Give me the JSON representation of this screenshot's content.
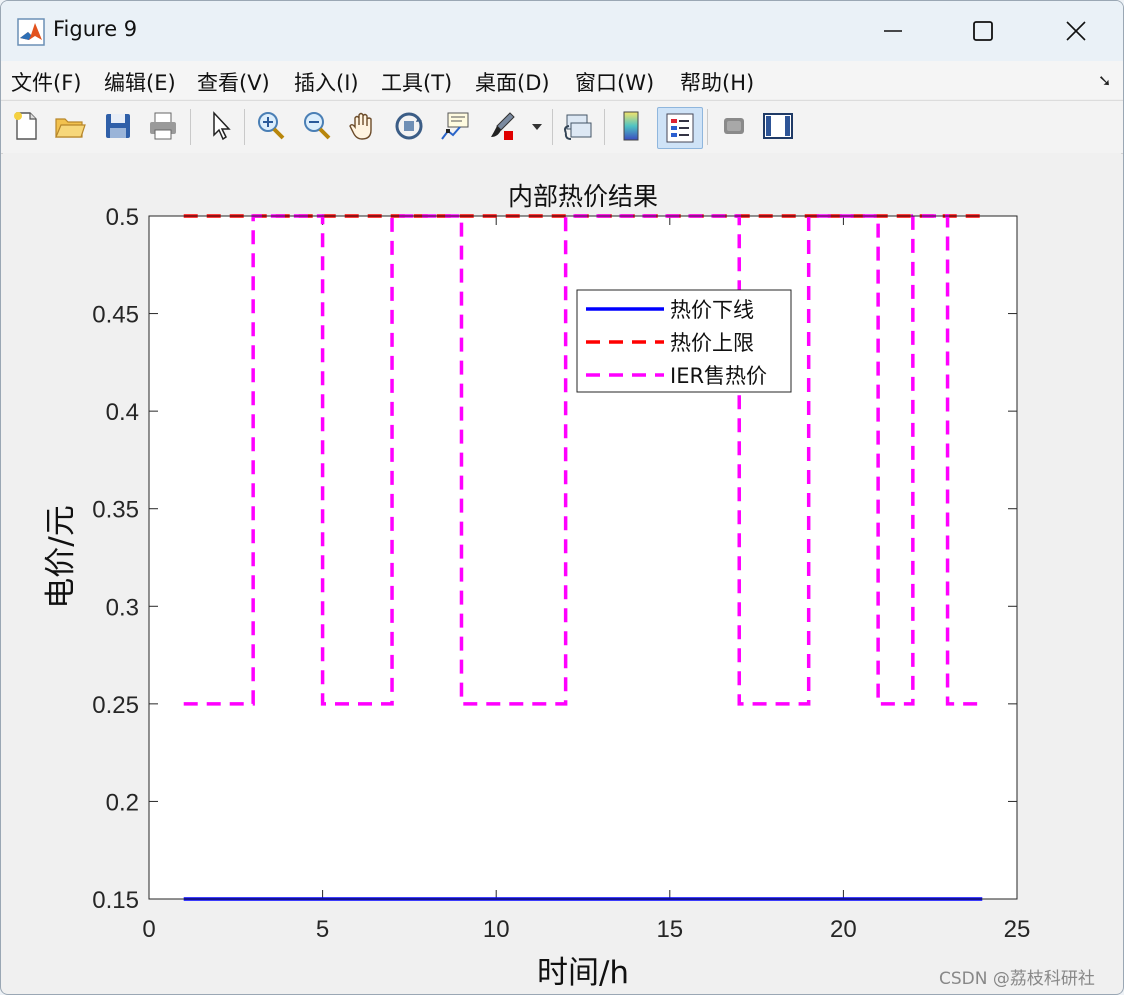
{
  "window": {
    "title": "Figure 9",
    "controls": [
      "minimize-icon",
      "maximize-icon",
      "close-icon"
    ]
  },
  "menubar": {
    "items": [
      {
        "label": "文件(F)"
      },
      {
        "label": "编辑(E)"
      },
      {
        "label": "查看(V)"
      },
      {
        "label": "插入(I)"
      },
      {
        "label": "工具(T)"
      },
      {
        "label": "桌面(D)"
      },
      {
        "label": "窗口(W)"
      },
      {
        "label": "帮助(H)"
      }
    ],
    "overflow_icon": "dock-arrow-icon"
  },
  "toolbar": {
    "buttons": [
      "new-figure-icon",
      "open-file-icon",
      "save-icon",
      "print-icon",
      "pointer-icon",
      "zoom-in-icon",
      "zoom-out-icon",
      "pan-hand-icon",
      "rotate-3d-icon",
      "data-cursor-icon",
      "brush-icon",
      "brush-dropdown-icon",
      "link-plot-icon",
      "colorbar-icon",
      "legend-icon",
      "hide-plot-tools-icon",
      "show-plot-tools-icon"
    ],
    "active": "legend-icon"
  },
  "chart_data": {
    "type": "line",
    "title": "内部热价结果",
    "xlabel": "时间/h",
    "ylabel": "电价/元",
    "xlim": [
      0,
      25
    ],
    "ylim": [
      0.15,
      0.5
    ],
    "xticks": [
      "0",
      "5",
      "10",
      "15",
      "20",
      "25"
    ],
    "yticks": [
      "0.15",
      "0.2",
      "0.25",
      "0.3",
      "0.35",
      "0.4",
      "0.45",
      "0.5"
    ],
    "grid": false,
    "legend_position": "upper-center",
    "series": [
      {
        "name": "热价下线",
        "color": "#0000ff",
        "style": "solid",
        "step": true,
        "x": [
          1,
          24
        ],
        "y": [
          0.15,
          0.15
        ]
      },
      {
        "name": "热价上限",
        "color": "#ff0000",
        "style": "dashed",
        "step": true,
        "x": [
          1,
          24
        ],
        "y": [
          0.5,
          0.5
        ]
      },
      {
        "name": "IER售热价",
        "color": "#ff00ff",
        "style": "dashed",
        "step": true,
        "x": [
          1,
          3,
          3,
          5,
          5,
          7,
          7,
          9,
          9,
          12,
          12,
          17,
          17,
          19,
          19,
          21,
          21,
          22,
          22,
          23,
          23,
          24
        ],
        "y": [
          0.25,
          0.25,
          0.5,
          0.5,
          0.25,
          0.25,
          0.5,
          0.5,
          0.25,
          0.25,
          0.5,
          0.5,
          0.25,
          0.25,
          0.5,
          0.5,
          0.25,
          0.25,
          0.5,
          0.5,
          0.25,
          0.25
        ]
      }
    ]
  },
  "watermark": "CSDN @荔枝科研社"
}
